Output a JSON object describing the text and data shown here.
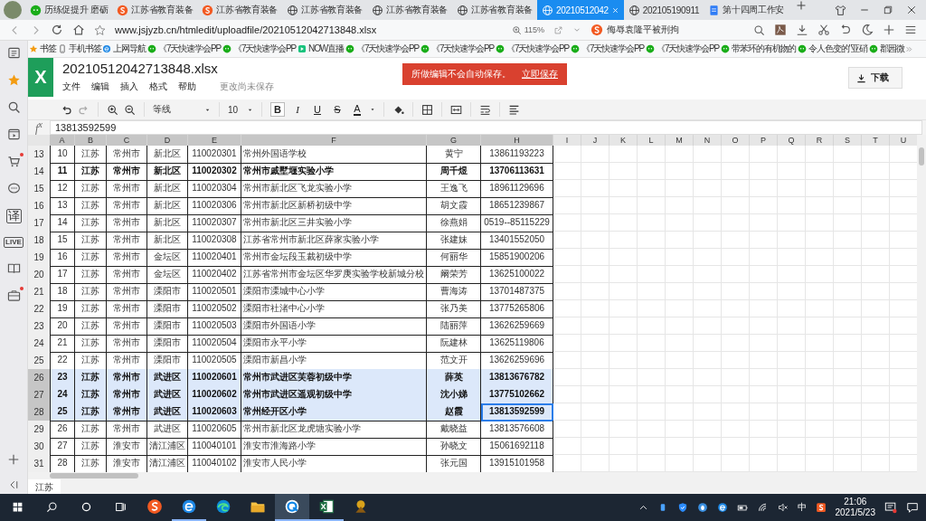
{
  "browser": {
    "tabs": [
      {
        "kind": "wechat",
        "title": "历练促提升 磨砺",
        "selected": false
      },
      {
        "kind": "sogou",
        "title": "江苏省教育装备",
        "selected": false
      },
      {
        "kind": "sogou",
        "title": "江苏省教育装备",
        "selected": false
      },
      {
        "kind": "globe",
        "title": "江苏省教育装备",
        "selected": false
      },
      {
        "kind": "globe",
        "title": "江苏省教育装备",
        "selected": false
      },
      {
        "kind": "globe",
        "title": "江苏省教育装备",
        "selected": false
      },
      {
        "kind": "globe",
        "title": "20210512042",
        "selected": true
      },
      {
        "kind": "globe",
        "title": "202105190911",
        "selected": false
      },
      {
        "kind": "doc",
        "title": "第十四周工作安",
        "selected": false
      }
    ],
    "url": "www.jsjyzb.cn/htmledit/uploadfile/20210512042713848.xlsx",
    "zoom": "115%",
    "search": "侮辱袁隆平被刑拘",
    "bookmarks": [
      {
        "kind": "star",
        "label": "书签"
      },
      {
        "kind": "phone",
        "label": "手机书签"
      },
      {
        "kind": "ie",
        "label": "上网导航"
      },
      {
        "kind": "wechat",
        "label": "《7天快速学会PP"
      },
      {
        "kind": "wechat",
        "label": "《7天快速学会PP"
      },
      {
        "kind": "now",
        "label": "NOW直播"
      },
      {
        "kind": "wechat",
        "label": "《7天快速学会PP"
      },
      {
        "kind": "wechat",
        "label": "《7天快速学会PP"
      },
      {
        "kind": "wechat",
        "label": "《7天快速学会PP"
      },
      {
        "kind": "wechat",
        "label": "《7天快速学会PP"
      },
      {
        "kind": "wechat",
        "label": "《7天快速学会PP"
      },
      {
        "kind": "wechat",
        "label": "带苯环的有机物的"
      },
      {
        "kind": "wechat",
        "label": "令人色变的\"亚硝"
      },
      {
        "kind": "wechat",
        "label": "郡园微"
      }
    ],
    "sidebar": [
      {
        "kind": "list"
      },
      {
        "kind": "star"
      },
      {
        "kind": "search"
      },
      {
        "kind": "video"
      },
      {
        "kind": "cart",
        "badge": true
      },
      {
        "kind": "chat"
      },
      {
        "kind": "text",
        "label": "译"
      },
      {
        "kind": "live",
        "label": "LIVE"
      },
      {
        "kind": "book"
      },
      {
        "kind": "briefcase",
        "badge": true
      }
    ]
  },
  "sheet": {
    "logo": "X",
    "file_name": "20210512042713848.xlsx",
    "menus": [
      "文件",
      "编辑",
      "插入",
      "格式",
      "帮助"
    ],
    "unsaved_note": "更改尚未保存",
    "banner": {
      "text": "所做编辑不会自动保存。",
      "link": "立即保存"
    },
    "download": "下载",
    "toolbar": {
      "font": "等线",
      "size": "10",
      "format_buttons": [
        {
          "kind": "bold",
          "label": "B",
          "selected": true
        },
        {
          "kind": "italic",
          "label": "I",
          "selected": false
        },
        {
          "kind": "underline",
          "label": "U",
          "selected": false
        },
        {
          "kind": "strike",
          "label": "S",
          "selected": false
        },
        {
          "kind": "color",
          "label": "A",
          "selected": false
        }
      ]
    },
    "formula": {
      "label": "f$^{x}$",
      "value": "13813592599"
    },
    "columns": [
      {
        "label": "A",
        "selected": true
      },
      {
        "label": "B",
        "selected": true
      },
      {
        "label": "C",
        "selected": true
      },
      {
        "label": "D",
        "selected": true
      },
      {
        "label": "E",
        "selected": true
      },
      {
        "label": "F",
        "selected": true
      },
      {
        "label": "G",
        "selected": true
      },
      {
        "label": "H",
        "selected": true
      },
      {
        "label": "I",
        "selected": false
      },
      {
        "label": "J",
        "selected": false
      },
      {
        "label": "K",
        "selected": false
      },
      {
        "label": "L",
        "selected": false
      },
      {
        "label": "M",
        "selected": false
      },
      {
        "label": "N",
        "selected": false
      },
      {
        "label": "O",
        "selected": false
      },
      {
        "label": "P",
        "selected": false
      },
      {
        "label": "Q",
        "selected": false
      },
      {
        "label": "R",
        "selected": false
      },
      {
        "label": "S",
        "selected": false
      },
      {
        "label": "T",
        "selected": false
      },
      {
        "label": "U",
        "selected": false
      }
    ],
    "rows": [
      {
        "n": "13",
        "cells": [
          "10",
          "江苏",
          "常州市",
          "新北区",
          "110020301",
          "常州外国语学校",
          "黄宁",
          "13861193223"
        ],
        "bold": false,
        "selected": false,
        "cursor": false
      },
      {
        "n": "14",
        "cells": [
          "11",
          "江苏",
          "常州市",
          "新北区",
          "110020302",
          "常州市戚墅堰实验小学",
          "周千煜",
          "13706113631"
        ],
        "bold": true,
        "selected": false,
        "cursor": false
      },
      {
        "n": "15",
        "cells": [
          "12",
          "江苏",
          "常州市",
          "新北区",
          "110020304",
          "常州市新北区飞龙实验小学",
          "王逸飞",
          "18961129696"
        ],
        "bold": false,
        "selected": false,
        "cursor": false
      },
      {
        "n": "16",
        "cells": [
          "13",
          "江苏",
          "常州市",
          "新北区",
          "110020306",
          "常州市新北区新桥初级中学",
          "胡文霞",
          "18651239867"
        ],
        "bold": false,
        "selected": false,
        "cursor": false
      },
      {
        "n": "17",
        "cells": [
          "14",
          "江苏",
          "常州市",
          "新北区",
          "110020307",
          "常州市新北区三井实验小学",
          "徐燕娟",
          "0519--85115229"
        ],
        "bold": false,
        "selected": false,
        "cursor": false
      },
      {
        "n": "18",
        "cells": [
          "15",
          "江苏",
          "常州市",
          "新北区",
          "110020308",
          "江苏省常州市新北区薛家实验小学",
          "张建妹",
          "13401552050"
        ],
        "bold": false,
        "selected": false,
        "cursor": false
      },
      {
        "n": "19",
        "cells": [
          "16",
          "江苏",
          "常州市",
          "金坛区",
          "110020401",
          "常州市金坛段玉裁初级中学",
          "何丽华",
          "15851900206"
        ],
        "bold": false,
        "selected": false,
        "cursor": false
      },
      {
        "n": "20",
        "cells": [
          "17",
          "江苏",
          "常州市",
          "金坛区",
          "110020402",
          "江苏省常州市金坛区华罗庚实验学校新城分校",
          "阚荣芳",
          "13625100022"
        ],
        "bold": false,
        "selected": false,
        "cursor": false
      },
      {
        "n": "21",
        "cells": [
          "18",
          "江苏",
          "常州市",
          "溧阳市",
          "110020501",
          "溧阳市溧城中心小学",
          "曹海涛",
          "13701487375"
        ],
        "bold": false,
        "selected": false,
        "cursor": false
      },
      {
        "n": "22",
        "cells": [
          "19",
          "江苏",
          "常州市",
          "溧阳市",
          "110020502",
          "溧阳市社渚中心小学",
          "张乃美",
          "13775265806"
        ],
        "bold": false,
        "selected": false,
        "cursor": false
      },
      {
        "n": "23",
        "cells": [
          "20",
          "江苏",
          "常州市",
          "溧阳市",
          "110020503",
          "溧阳市外国语小学",
          "陆丽萍",
          "13626259669"
        ],
        "bold": false,
        "selected": false,
        "cursor": false
      },
      {
        "n": "24",
        "cells": [
          "21",
          "江苏",
          "常州市",
          "溧阳市",
          "110020504",
          "溧阳市永平小学",
          "阮建林",
          "13625119806"
        ],
        "bold": false,
        "selected": false,
        "cursor": false
      },
      {
        "n": "25",
        "cells": [
          "22",
          "江苏",
          "常州市",
          "溧阳市",
          "110020505",
          "溧阳市新昌小学",
          "范文开",
          "13626259696"
        ],
        "bold": false,
        "selected": false,
        "cursor": false
      },
      {
        "n": "26",
        "cells": [
          "23",
          "江苏",
          "常州市",
          "武进区",
          "110020601",
          "常州市武进区芙蓉初级中学",
          "薛英",
          "13813676782"
        ],
        "bold": true,
        "selected": true,
        "cursor": false
      },
      {
        "n": "27",
        "cells": [
          "24",
          "江苏",
          "常州市",
          "武进区",
          "110020602",
          "常州市武进区遥观初级中学",
          "沈小娣",
          "13775102662"
        ],
        "bold": true,
        "selected": true,
        "cursor": false
      },
      {
        "n": "28",
        "cells": [
          "25",
          "江苏",
          "常州市",
          "武进区",
          "110020603",
          "常州经开区小学",
          "赵霞",
          "13813592599"
        ],
        "bold": true,
        "selected": true,
        "cursor": true
      },
      {
        "n": "29",
        "cells": [
          "26",
          "江苏",
          "常州市",
          "武进区",
          "110020605",
          "常州市新北区龙虎塘实验小学",
          "戴晓益",
          "13813576608"
        ],
        "bold": false,
        "selected": false,
        "cursor": false
      },
      {
        "n": "30",
        "cells": [
          "27",
          "江苏",
          "淮安市",
          "清江浦区",
          "110040101",
          "淮安市淮海路小学",
          "孙晓文",
          "15061692118"
        ],
        "bold": false,
        "selected": false,
        "cursor": false
      },
      {
        "n": "31",
        "cells": [
          "28",
          "江苏",
          "淮安市",
          "清江浦区",
          "110040102",
          "淮安市人民小学",
          "张元国",
          "13915101958"
        ],
        "bold": false,
        "selected": false,
        "cursor": false
      }
    ],
    "sheet_tabs": [
      {
        "label": "江苏",
        "selected": true
      }
    ]
  },
  "taskbar": {
    "apps": [
      {
        "kind": "sogou",
        "running": false,
        "selected": false
      },
      {
        "kind": "ie",
        "running": true,
        "selected": false
      },
      {
        "kind": "edge",
        "running": false,
        "selected": false
      },
      {
        "kind": "folder",
        "running": false,
        "selected": false
      },
      {
        "kind": "browser360",
        "running": true,
        "selected": true
      },
      {
        "kind": "excel",
        "running": true,
        "selected": false
      },
      {
        "kind": "game",
        "running": false,
        "selected": false
      }
    ],
    "ime": "中",
    "time": "21:06",
    "date": "2021/5/23"
  }
}
